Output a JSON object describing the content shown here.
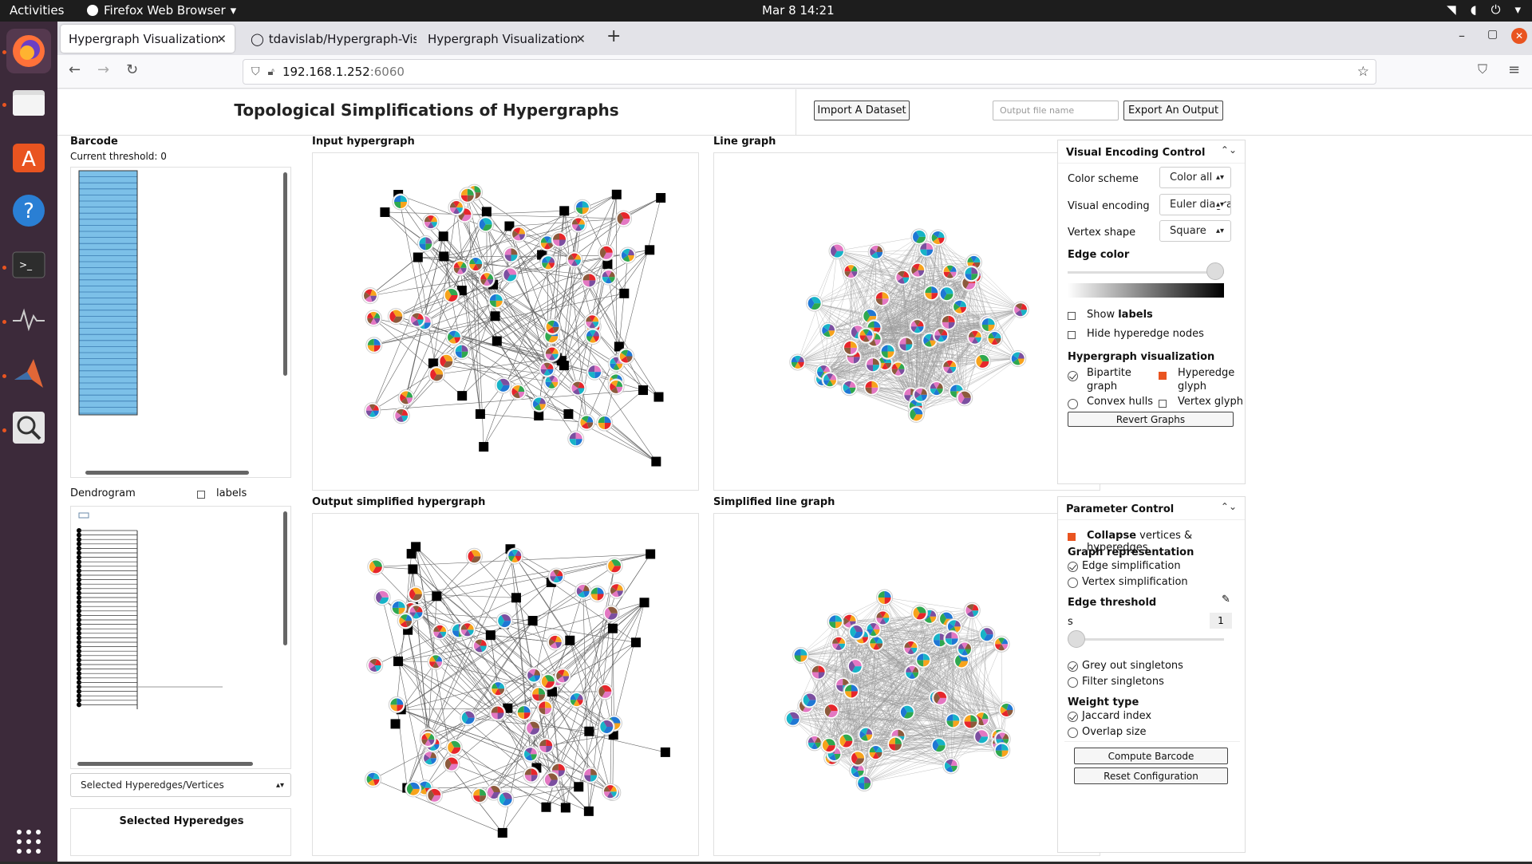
{
  "topbar": {
    "activities": "Activities",
    "app_menu": "Firefox Web Browser",
    "clock": "Mar 8  14:21"
  },
  "browser": {
    "tabs": [
      {
        "label": "Hypergraph Visualization"
      },
      {
        "label": "tdavislab/Hypergraph-Vis"
      },
      {
        "label": "Hypergraph Visualization"
      }
    ],
    "url_host": "192.168.1.252",
    "url_port": ":6060"
  },
  "page": {
    "title": "Topological Simplifications of Hypergraphs",
    "import_button": "Import A Dataset",
    "output_placeholder": "Output file name",
    "export_button": "Export An Output"
  },
  "left": {
    "barcode_title": "Barcode",
    "threshold_text": "Current threshold: 0",
    "dendrogram_title": "Dendrogram",
    "labels_text": "labels",
    "selected_dropdown": "Selected Hyperedges/Vertices",
    "selected_title": "Selected Hyperedges"
  },
  "graphs": {
    "input_title": "Input hypergraph",
    "line_title": "Line graph",
    "output_title": "Output simplified hypergraph",
    "simplified_line_title": "Simplified line graph"
  },
  "visual_control": {
    "title": "Visual Encoding Control",
    "color_scheme_label": "Color scheme",
    "color_scheme_value": "Color all",
    "visual_encoding_label": "Visual encoding",
    "visual_encoding_value": "Euler diagrar",
    "vertex_shape_label": "Vertex shape",
    "vertex_shape_value": "Square",
    "edge_color_label": "Edge color",
    "show_prefix": "Show",
    "show_labels_bold": "labels",
    "hide_hyperedge": "Hide hyperedge nodes",
    "hyper_vis_title": "Hypergraph visualization",
    "bipartite": "Bipartite graph",
    "hyperedge_glyph": "Hyperedge glyph",
    "convex_hulls": "Convex hulls",
    "vertex_glyph": "Vertex glyph",
    "revert_button": "Revert Graphs"
  },
  "param_control": {
    "title": "Parameter Control",
    "collapse_bold": "Collapse",
    "collapse_rest": "vertices & hyperedges",
    "graph_rep_title": "Graph representation",
    "edge_simplification": "Edge simplification",
    "vertex_simplification": "Vertex simplification",
    "edge_threshold_title": "Edge threshold",
    "s_label": "s",
    "s_value": "1",
    "slider_value": 0,
    "grey_out": "Grey out singletons",
    "filter_singletons": "Filter singletons",
    "weight_type_title": "Weight type",
    "jaccard": "Jaccard index",
    "overlap": "Overlap size",
    "compute_button": "Compute Barcode",
    "reset_button": "Reset Configuration"
  },
  "colors": {
    "accent": "#e95420",
    "barcode_fill": "#7cc0e8",
    "pie": [
      "#e6262b",
      "#f7a31c",
      "#2fa84f",
      "#1f77d4",
      "#17b3c7",
      "#7b4fa0",
      "#e377c2",
      "#8c5a3c"
    ]
  }
}
